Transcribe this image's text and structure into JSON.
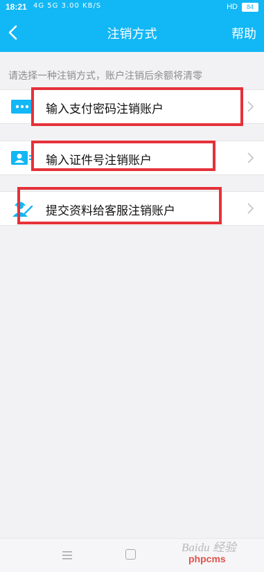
{
  "status_bar": {
    "time": "18:21",
    "signal_text": "4G 5G 3.00 KB/S",
    "hd_label": "HD",
    "battery": "84"
  },
  "nav": {
    "title": "注销方式",
    "help_label": "帮助"
  },
  "hint": "请选择一种注销方式，账户注销后余额将清零",
  "options": [
    {
      "label": "输入支付密码注销账户",
      "icon": "password-keypad-icon"
    },
    {
      "label": "输入证件号注销账户",
      "icon": "id-card-icon"
    },
    {
      "label": "提交资料给客服注销账户",
      "icon": "customer-service-icon"
    }
  ],
  "watermark": {
    "line1": "Baidu 经验",
    "line2": "phpcms"
  },
  "colors": {
    "brand": "#12b7f5",
    "highlight": "#e5313a"
  }
}
